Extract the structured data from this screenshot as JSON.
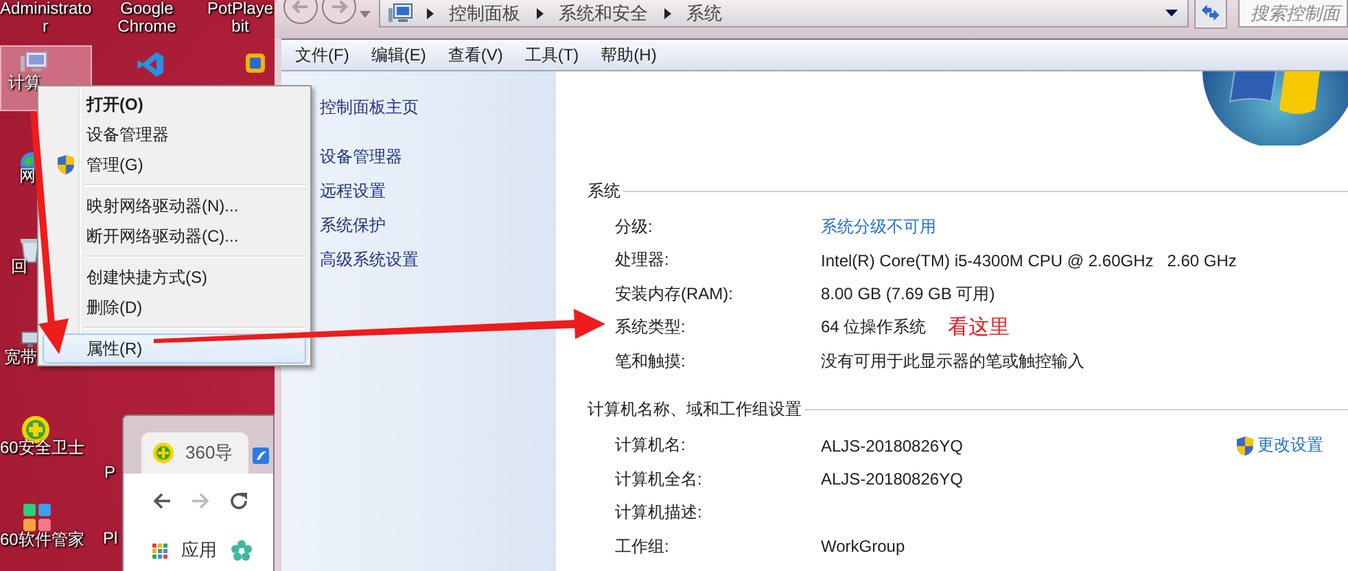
{
  "desktop_icons": [
    {
      "label": "Administrato\nr"
    },
    {
      "label": "Google\nChrome"
    },
    {
      "label": "PotPlaye\nbit"
    },
    {
      "label": "计算",
      "selected": true
    },
    {
      "label": "网"
    },
    {
      "label": "回"
    },
    {
      "label": "宽带"
    },
    {
      "label": "60安全卫士"
    },
    {
      "label": "60软件管家"
    },
    {
      "label": "P"
    },
    {
      "label": "Pl"
    }
  ],
  "context_menu": {
    "groups": [
      [
        {
          "label": "打开(O)",
          "bold": true,
          "kind": "plain",
          "selected": false
        },
        {
          "label": "设备管理器",
          "bold": false,
          "kind": "plain",
          "selected": false
        },
        {
          "label": "管理(G)",
          "bold": false,
          "kind": "admin",
          "selected": false
        }
      ],
      [
        {
          "label": "映射网络驱动器(N)...",
          "bold": false,
          "kind": "plain",
          "selected": false
        },
        {
          "label": "断开网络驱动器(C)...",
          "bold": false,
          "kind": "plain",
          "selected": false
        }
      ],
      [
        {
          "label": "创建快捷方式(S)",
          "bold": false,
          "kind": "plain",
          "selected": false
        },
        {
          "label": "删除(D)",
          "bold": false,
          "kind": "plain",
          "selected": false
        }
      ],
      [
        {
          "label": "属性(R)",
          "bold": false,
          "kind": "plain",
          "selected": true
        }
      ]
    ]
  },
  "browser": {
    "tab": "360导",
    "bookmarks": [
      {
        "label": "应用"
      }
    ]
  },
  "window": {
    "breadcrumb": [
      "控制面板",
      "系统和安全",
      "系统"
    ],
    "search": {
      "placeholder": "搜索控制面"
    },
    "menu": [
      "文件(F)",
      "编辑(E)",
      "查看(V)",
      "工具(T)",
      "帮助(H)"
    ],
    "nav": [
      "控制面板主页",
      "设备管理器",
      "远程设置",
      "系统保护",
      "高级系统设置"
    ],
    "sections": [
      {
        "title": "系统",
        "rows": [
          {
            "label": "分级:",
            "value": "系统分级不可用",
            "kind": "link"
          },
          {
            "label": "处理器:",
            "value": "Intel(R) Core(TM) i5-4300M CPU @ 2.60GHz   2.60 GHz",
            "kind": "text"
          },
          {
            "label": "安装内存(RAM):",
            "value": "8.00 GB (7.69 GB 可用)",
            "kind": "text"
          },
          {
            "label": "系统类型:",
            "value": "64 位操作系统",
            "kind": "text",
            "note": "看这里"
          },
          {
            "label": "笔和触摸:",
            "value": "没有可用于此显示器的笔或触控输入",
            "kind": "text"
          }
        ]
      },
      {
        "title": "计算机名称、域和工作组设置",
        "action": "更改设置",
        "rows": [
          {
            "label": "计算机名:",
            "value": "ALJS-20180826YQ",
            "kind": "text"
          },
          {
            "label": "计算机全名:",
            "value": "ALJS-20180826YQ",
            "kind": "text"
          },
          {
            "label": "计算机描述:",
            "kind": "text"
          },
          {
            "label": "工作组:",
            "value": "WorkGroup",
            "kind": "text"
          }
        ]
      }
    ]
  }
}
